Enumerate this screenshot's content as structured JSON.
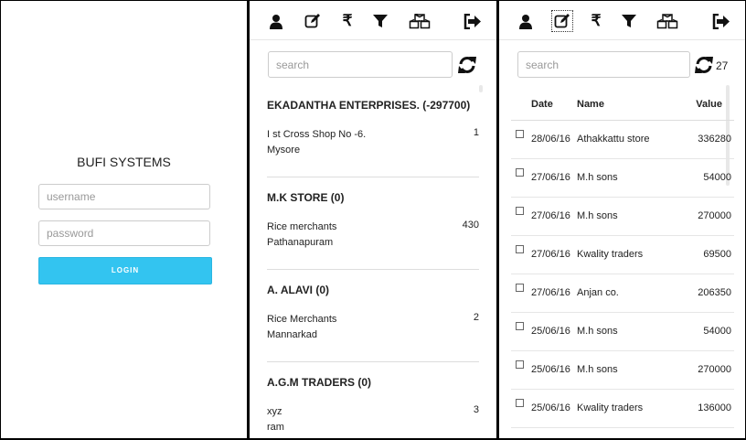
{
  "login": {
    "title": "BUFI SYSTEMS",
    "username_placeholder": "username",
    "password_placeholder": "password",
    "button_label": "LOGIN"
  },
  "toolbar_icons": [
    "user-icon",
    "edit-icon",
    "rupee-icon",
    "filter-icon",
    "cubes-icon",
    "sign-out-icon"
  ],
  "rupee_symbol": "₹",
  "parties": {
    "search_placeholder": "search",
    "items": [
      {
        "title": "EKADANTHA ENTERPRISES. (-297700)",
        "line1": "I st Cross Shop No -6.",
        "line2": "Mysore",
        "count": "1"
      },
      {
        "title": "M.K STORE (0)",
        "line1": "Rice merchants",
        "line2": "Pathanapuram",
        "count": "430"
      },
      {
        "title": "A. ALAVI (0)",
        "line1": "Rice Merchants",
        "line2": "Mannarkad",
        "count": "2"
      },
      {
        "title": "A.G.M TRADERS (0)",
        "line1": "xyz",
        "line2": "ram",
        "count": "3"
      }
    ]
  },
  "orders": {
    "search_placeholder": "search",
    "count": "27",
    "columns": {
      "date": "Date",
      "name": "Name",
      "value": "Value"
    },
    "rows": [
      {
        "date": "28/06/16",
        "name": "Athakkattu store",
        "value": "336280"
      },
      {
        "date": "27/06/16",
        "name": "M.h sons",
        "value": "54000"
      },
      {
        "date": "27/06/16",
        "name": "M.h sons",
        "value": "270000"
      },
      {
        "date": "27/06/16",
        "name": "Kwality traders",
        "value": "69500"
      },
      {
        "date": "27/06/16",
        "name": "Anjan co.",
        "value": "206350"
      },
      {
        "date": "25/06/16",
        "name": "M.h sons",
        "value": "54000"
      },
      {
        "date": "25/06/16",
        "name": "M.h sons",
        "value": "270000"
      },
      {
        "date": "25/06/16",
        "name": "Kwality traders",
        "value": "136000"
      }
    ]
  },
  "colors": {
    "accent": "#33c4f0",
    "divider": "#000000"
  }
}
